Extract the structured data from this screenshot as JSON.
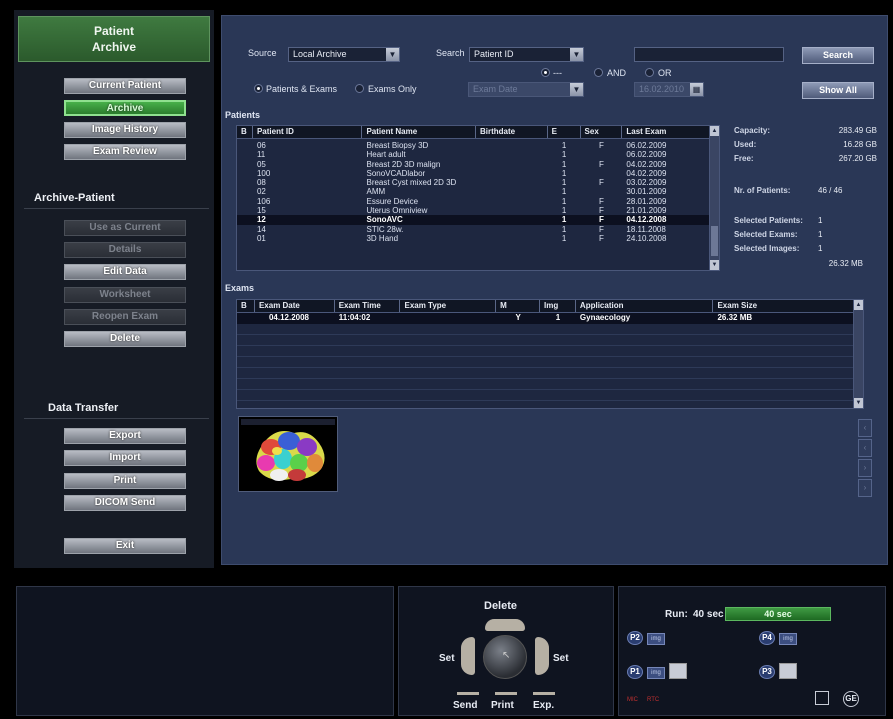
{
  "left": {
    "title_line1": "Patient",
    "title_line2": "Archive",
    "nav": [
      "Current Patient",
      "Archive",
      "Image History",
      "Exam Review"
    ],
    "section_archive_patient": "Archive-Patient",
    "actions": [
      "Use as Current",
      "Details",
      "Edit Data",
      "Worksheet",
      "Reopen Exam",
      "Delete"
    ],
    "section_data_transfer": "Data Transfer",
    "transfer": [
      "Export",
      "Import",
      "Print",
      "DICOM Send"
    ],
    "exit": "Exit"
  },
  "search": {
    "source_label": "Source",
    "source_value": "Local Archive",
    "search_label": "Search",
    "search_value": "Patient ID",
    "search_input": "",
    "search_button": "Search",
    "show_all_button": "Show All",
    "radio_patients_exams": "Patients & Exams",
    "radio_exams_only": "Exams Only",
    "dash_label": "---",
    "and_label": "AND",
    "or_label": "OR",
    "exam_date_combo": "Exam Date",
    "date_combo": "16.02.2010"
  },
  "patients": {
    "section_label": "Patients",
    "columns": [
      "B",
      "Patient ID",
      "Patient Name",
      "Birthdate",
      "E",
      "Sex",
      "Last Exam"
    ],
    "rows": [
      {
        "id": "06",
        "name": "Breast Biopsy 3D",
        "birth": "",
        "e": "1",
        "sex": "F",
        "last": "06.02.2009"
      },
      {
        "id": "11",
        "name": "Heart adult",
        "birth": "",
        "e": "1",
        "sex": "",
        "last": "06.02.2009"
      },
      {
        "id": "05",
        "name": "Breast 2D 3D malign",
        "birth": "",
        "e": "1",
        "sex": "F",
        "last": "04.02.2009"
      },
      {
        "id": "100",
        "name": "SonoVCADlabor",
        "birth": "",
        "e": "1",
        "sex": "",
        "last": "04.02.2009"
      },
      {
        "id": "08",
        "name": "Breast Cyst mixed 2D 3D",
        "birth": "",
        "e": "1",
        "sex": "F",
        "last": "03.02.2009"
      },
      {
        "id": "02",
        "name": "AMM",
        "birth": "",
        "e": "1",
        "sex": "",
        "last": "30.01.2009"
      },
      {
        "id": "106",
        "name": "Essure Device",
        "birth": "",
        "e": "1",
        "sex": "F",
        "last": "28.01.2009"
      },
      {
        "id": "15",
        "name": "Uterus Omniview",
        "birth": "",
        "e": "1",
        "sex": "F",
        "last": "21.01.2009"
      },
      {
        "id": "12",
        "name": "SonoAVC",
        "birth": "",
        "e": "1",
        "sex": "F",
        "last": "04.12.2008"
      },
      {
        "id": "14",
        "name": "STIC 28w.",
        "birth": "",
        "e": "1",
        "sex": "F",
        "last": "18.11.2008"
      },
      {
        "id": "01",
        "name": "3D Hand",
        "birth": "",
        "e": "1",
        "sex": "F",
        "last": "24.10.2008"
      }
    ],
    "selected_index": 8
  },
  "stats": {
    "capacity_label": "Capacity:",
    "capacity": "283.49 GB",
    "used_label": "Used:",
    "used": "16.28 GB",
    "free_label": "Free:",
    "free": "267.20 GB",
    "nr_patients_label": "Nr. of Patients:",
    "nr_patients": "46 / 46",
    "sel_patients_label": "Selected Patients:",
    "sel_patients": "1",
    "sel_exams_label": "Selected Exams:",
    "sel_exams": "1",
    "sel_images_label": "Selected Images:",
    "sel_images": "1",
    "sel_size": "26.32 MB"
  },
  "exams": {
    "section_label": "Exams",
    "columns": [
      "B",
      "Exam Date",
      "Exam Time",
      "Exam Type",
      "M",
      "Img",
      "Application",
      "Exam Size"
    ],
    "rows": [
      {
        "b": "",
        "date": "04.12.2008",
        "time": "11:04:02",
        "type": "",
        "m": "Y",
        "img": "1",
        "app": "Gynaecology",
        "size": "26.32 MB"
      }
    ]
  },
  "bottom": {
    "delete_label": "Delete",
    "set_left": "Set",
    "set_right": "Set",
    "send": "Send",
    "print": "Print",
    "exp": "Exp.",
    "run_label": "Run:",
    "run_value": "40 sec",
    "run_bar": "40 sec",
    "p1": "P1",
    "p2": "P2",
    "p3": "P3",
    "p4": "P4",
    "img": "img",
    "mic": "MIC",
    "rtc": "RTC",
    "ge_logo": "GE",
    "colors": {
      "progress": "#2e7d32",
      "accent_green": "#3f7a40"
    }
  }
}
